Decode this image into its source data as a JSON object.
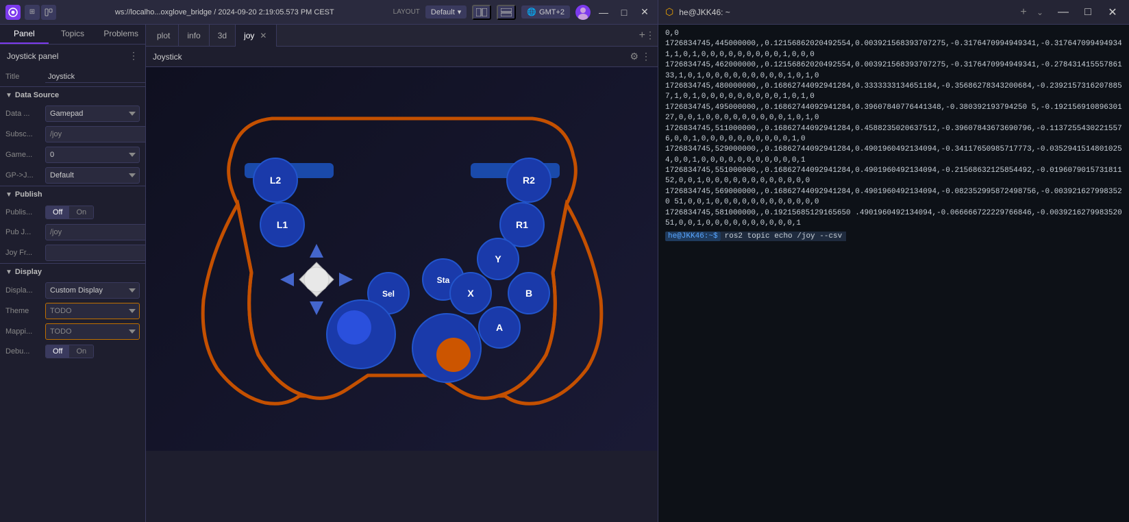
{
  "titleBar": {
    "logo": "F",
    "url": "ws://localho...oxglove_bridge / 2024-09-20 2:19:05.573 PM CEST",
    "layout": "LAYOUT",
    "layoutName": "Default",
    "timezone": "GMT+2",
    "minimizeBtn": "—",
    "maximizeBtn": "□",
    "closeBtn": "✕"
  },
  "sidebar": {
    "tabs": [
      "Panel",
      "Topics",
      "Problems"
    ],
    "activeTab": "Panel",
    "header": "Joystick panel",
    "title": {
      "label": "Title",
      "value": "Joystick"
    },
    "dataSource": {
      "sectionLabel": "Data Source",
      "dataLabel": "Data ...",
      "dataValue": "Gamepad",
      "subscribeLabel": "Subsc...",
      "subscribeValue": "/joy",
      "gamepadLabel": "Game...",
      "gamepadValue": "0",
      "gpLabel": "GP->J...",
      "gpValue": "Default"
    },
    "publish": {
      "sectionLabel": "Publish",
      "publishLabel": "Publis...",
      "publishOffLabel": "Off",
      "publishOnLabel": "On",
      "pubJLabel": "Pub J...",
      "pubJValue": "/joy",
      "joyFrLabel": "Joy Fr..."
    },
    "display": {
      "sectionLabel": "Display",
      "displayLabel": "Displa...",
      "displayValue": "Custom Display",
      "themeLabel": "Theme",
      "themeValue": "TODO",
      "mappingLabel": "Mappi...",
      "mappingValue": "TODO",
      "debugLabel": "Debu...",
      "debugOffLabel": "Off",
      "debugOnLabel": "On"
    }
  },
  "tabs": [
    {
      "label": "plot",
      "active": false,
      "closeable": false
    },
    {
      "label": "info",
      "active": false,
      "closeable": false
    },
    {
      "label": "3d",
      "active": false,
      "closeable": false
    },
    {
      "label": "joy",
      "active": true,
      "closeable": true
    }
  ],
  "joystickPanel": {
    "title": "Joystick",
    "buttons": {
      "L2": "L2",
      "L1": "L1",
      "R2": "R2",
      "R1": "R1",
      "Y": "Y",
      "X": "X",
      "B": "B",
      "A": "A",
      "Sel": "Sel",
      "Sta": "Sta"
    }
  },
  "terminal": {
    "title": "he@JKK46: ~",
    "lines": [
      "0,0",
      "1726834745,445000000,,0.12156862020492554,0.003921568393707275,-0.3176470994949341,-0.3176470994949341,1,0,1,0,0,0,0,0,0,0,0,0,1,0,0,0",
      "1726834745,462000000,,0.12156862020492554,0.003921568393707275,-0.3176470994949341,-0.27843141555786133,1,0,1,0,0,0,0,0,0,0,0,0,1,0,1,0",
      "1726834745,480000000,,0.16862744092941284,0.3333333134651184,-0.35686278343200684,-0.23921573162078857,1,0,1,0,0,0,0,0,0,0,0,0,1,0,1,0",
      "1726834745,495000000,,0.16862744092941284,0.39607840776441348,-0.380392193794250 5,-0.19215691089630127,0,0,1,0,0,0,0,0,0,0,0,0,1,0,1,0",
      "1726834745,511000000,,0.16862744092941284,0.4588235020637512,-0.39607843673690796,-0.11372554302215576,0,0,1,0,0,0,0,0,0,0,0,0,0,1,0",
      "1726834745,529000000,,0.16862744092941284,0.4901960492134094,-0.34117650985717773,-0.03529415148010254,0,0,1,0,0,0,0,0,0,0,0,0,0,0,1",
      "1726834745,551000000,,0.16862744092941284,0.4901960492134094,-0.21568632125854492,-0.019607901573181152,0,0,1,0,0,0,0,0,0,0,0,0,0,0,0",
      "1726834745,569000000,,0.16862744092941284,0.4901960492134094,-0.082352995872498756,-0.0039216279983520 51,0,0,1,0,0,0,0,0,0,0,0,0,0,0,0",
      "1726834745,581000000,,0.19215685129165650 .4901960492134094,-0.066666722229766846,-0.003921627998352051,0,0,1,0,0,0,0,0,0,0,0,0,0,1"
    ],
    "prompt": "he@JKK46:~$",
    "command": "ros2 topic echo /joy --csv"
  }
}
